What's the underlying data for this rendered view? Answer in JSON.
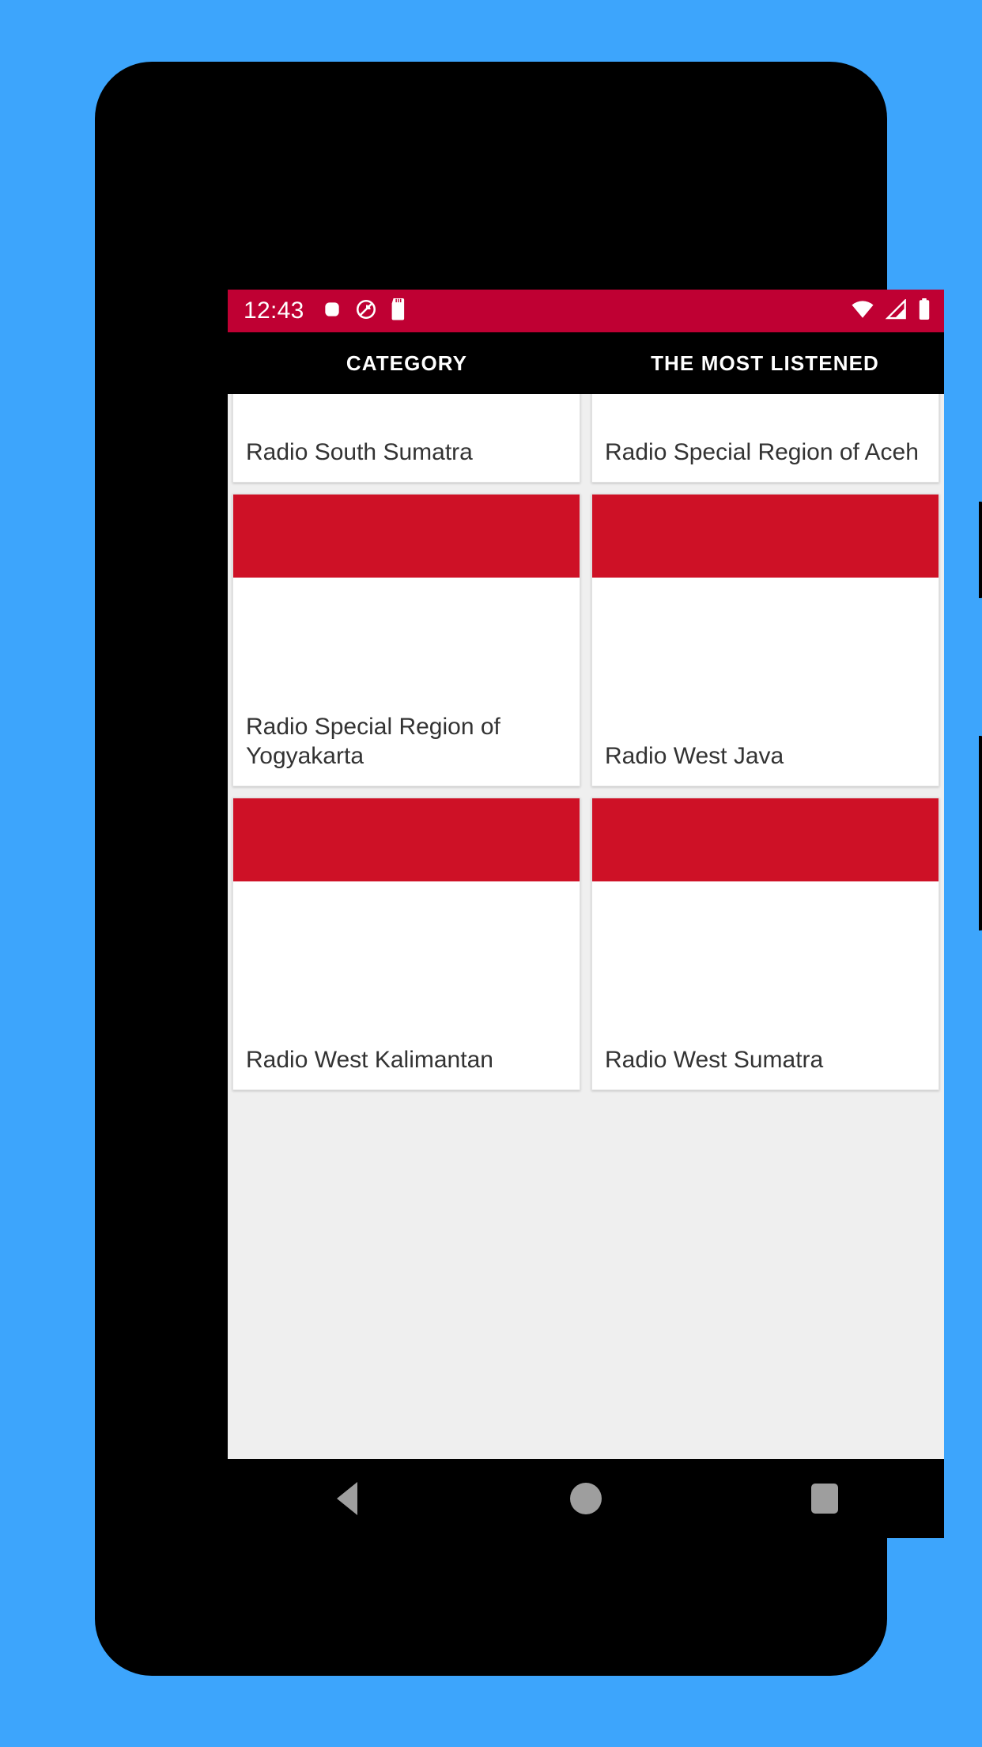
{
  "theme": {
    "page_background": "#3da5fc",
    "phone_body": "#000000",
    "status_bar": "#bf0033",
    "flag_red": "#ce1126",
    "flag_white": "#ffffff",
    "app_background": "#efefef",
    "card_background": "#ffffff",
    "tab_bar": "#000000",
    "tab_text": "#ffffff",
    "card_title_text": "#333333",
    "nav_icon": "#9e9e9e"
  },
  "status_bar": {
    "time": "12:43",
    "left_icons": [
      "screen-record-icon",
      "do-not-disturb-icon",
      "sd-card-icon"
    ],
    "right_icons": [
      "wifi-icon",
      "cellular-signal-icon",
      "battery-icon"
    ]
  },
  "tabs": [
    {
      "label": "CATEGORY",
      "selected": true
    },
    {
      "label": "THE MOST LISTENED",
      "selected": false
    }
  ],
  "cards": [
    {
      "title": "Radio South Sumatra",
      "has_image": false
    },
    {
      "title": "Radio Special Region of Aceh",
      "has_image": false
    },
    {
      "title": "Radio Special Region of Yogyakarta",
      "has_image": true
    },
    {
      "title": "Radio West Java",
      "has_image": true
    },
    {
      "title": "Radio West Kalimantan",
      "has_image": true
    },
    {
      "title": "Radio West Sumatra",
      "has_image": true
    }
  ],
  "nav_bar": {
    "back_label": "Back",
    "home_label": "Home",
    "recents_label": "Recents"
  }
}
